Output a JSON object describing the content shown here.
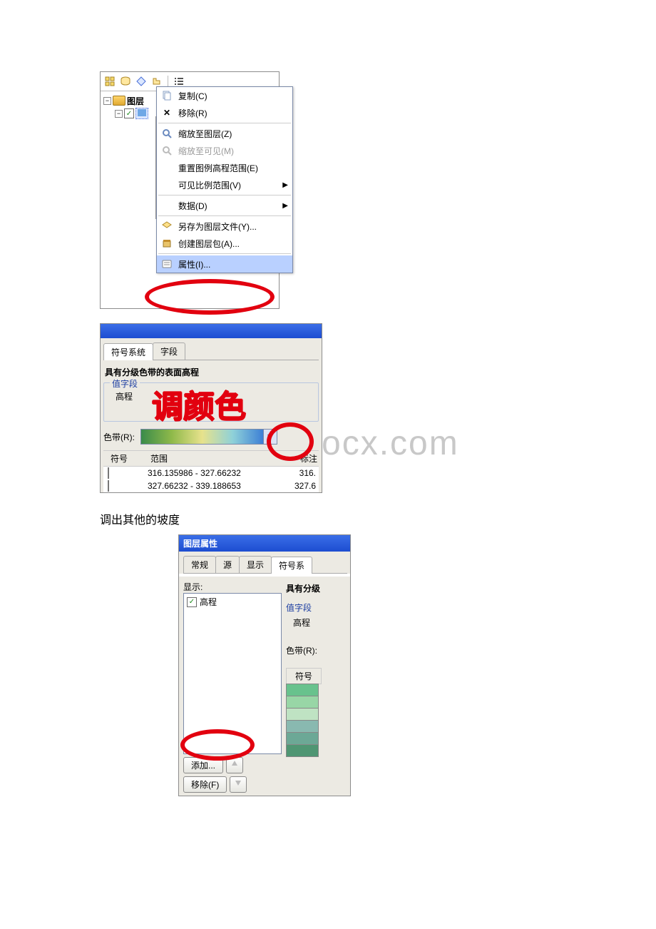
{
  "panel1": {
    "rootLabel": "图层",
    "swatchColors": [
      "#d8d8d8",
      "#9f4d24",
      "#6a3a22",
      "#cda63a",
      "#6aa22f",
      "#9fcc8f",
      "#2f9a54",
      "#d9f0cc",
      "#bcdbe6"
    ],
    "menu": {
      "copy": "复制(C)",
      "remove": "移除(R)",
      "zoomToLayer": "缩放至图层(Z)",
      "zoomToVisible": "缩放至可见(M)",
      "resetLegend": "重置图例高程范围(E)",
      "visibleScale": "可见比例范围(V)",
      "data": "数据(D)",
      "saveAsLayerFile": "另存为图层文件(Y)...",
      "createLayerPackage": "创建图层包(A)...",
      "properties": "属性(I)..."
    }
  },
  "panel2": {
    "tabs": {
      "sym": "符号系统",
      "fields": "字段"
    },
    "heading": "具有分级色带的表面高程",
    "valueFieldGroup": "值字段",
    "valueField": "高程",
    "rampLabel": "色带(R):",
    "hdrSymbol": "符号",
    "hdrRange": "范围",
    "hdrLabel": "标注",
    "rows": [
      {
        "color": "#a3a45d",
        "range": "316.135986 - 327.66232",
        "label": "316."
      },
      {
        "color": "#6fcac2",
        "range": "327.66232 - 339.188653",
        "label": "327.6"
      }
    ],
    "handtext": "调颜色",
    "watermark": "ocx.com"
  },
  "caption": "调出其他的坡度",
  "panel3": {
    "title": "图层属性",
    "tabs": {
      "general": "常规",
      "source": "源",
      "display": "显示",
      "sym": "符号系"
    },
    "showLabel": "显示:",
    "listOption": "高程",
    "addBtn": "添加...",
    "removeBtn": "移除(F)",
    "right": {
      "heading": "具有分级",
      "valueFieldGroup": "值字段",
      "valueField": "高程",
      "rampLabel": "色带(R):",
      "symHeader": "符号",
      "swatches": [
        "#68c28d",
        "#98d6a6",
        "#bfe3c3",
        "#89b9b0",
        "#6ca896",
        "#4f9673"
      ]
    }
  }
}
